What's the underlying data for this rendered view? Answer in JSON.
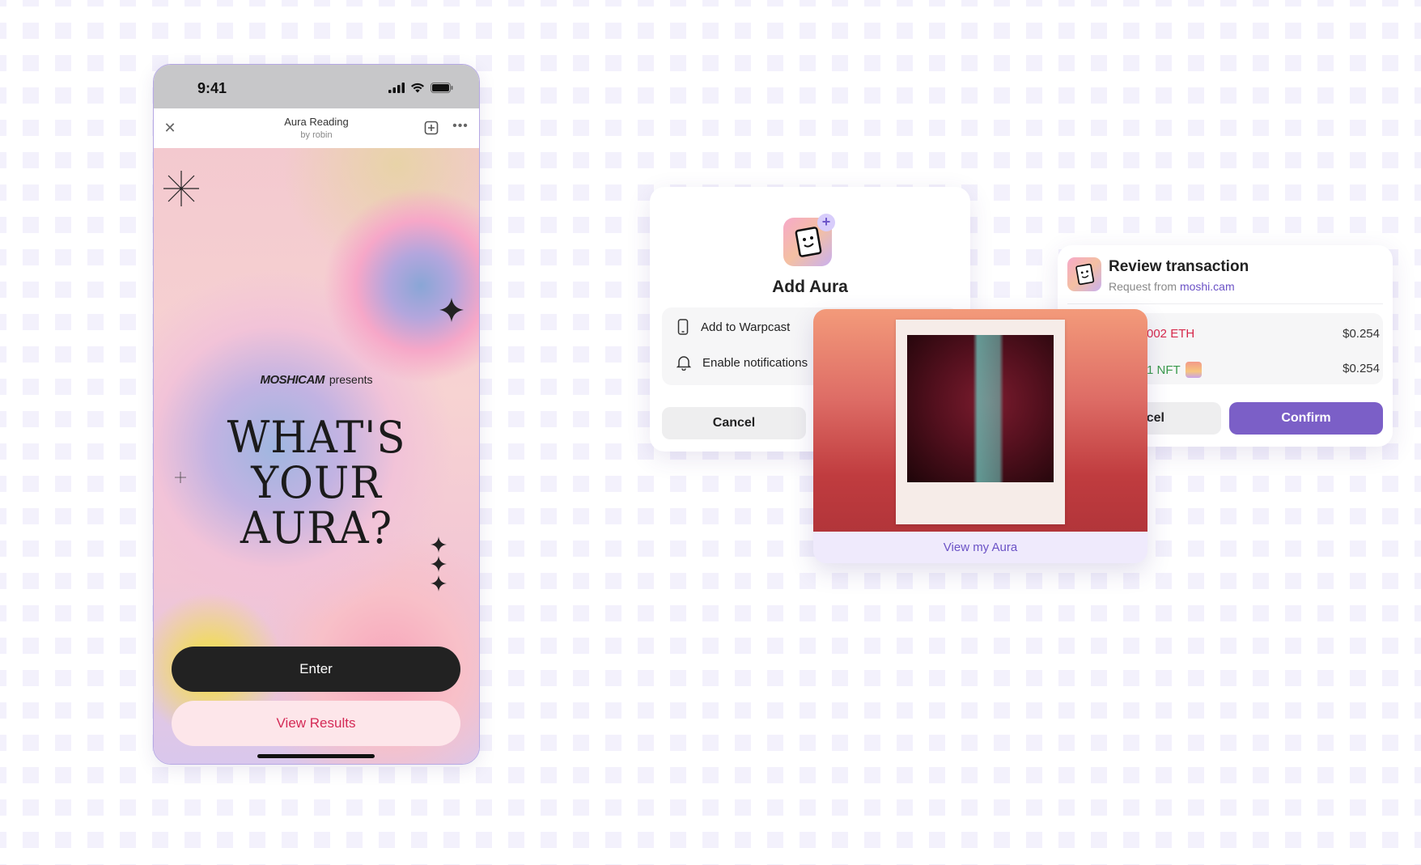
{
  "phone": {
    "status_time": "9:41",
    "app_title": "Aura Reading",
    "app_subtitle": "by robin",
    "brand": "MOSHICAM",
    "brand_suffix": "presents",
    "headline_lines": [
      "WHAT'S",
      "YOUR",
      "AURA?"
    ],
    "enter_label": "Enter",
    "results_label": "View Results"
  },
  "add_dialog": {
    "title": "Add Aura",
    "options": [
      {
        "label": "Add to Warpcast",
        "icon": "phone-icon"
      },
      {
        "label": "Enable notifications",
        "icon": "bell-icon"
      }
    ],
    "cancel_label": "Cancel"
  },
  "review": {
    "title": "Review transaction",
    "request_prefix": "Request from",
    "request_domain": "moshi.cam",
    "row1_amount": "002 ETH",
    "row1_value": "$0.254",
    "row2_amount": "1 NFT",
    "row2_value": "$0.254",
    "cancel_label": "cel",
    "confirm_label": "Confirm"
  },
  "result": {
    "view_label": "View my Aura"
  },
  "colors": {
    "accent": "#7b5fc7",
    "link": "#6b52c6",
    "danger": "#d6284a",
    "success": "#3a9a4c"
  }
}
